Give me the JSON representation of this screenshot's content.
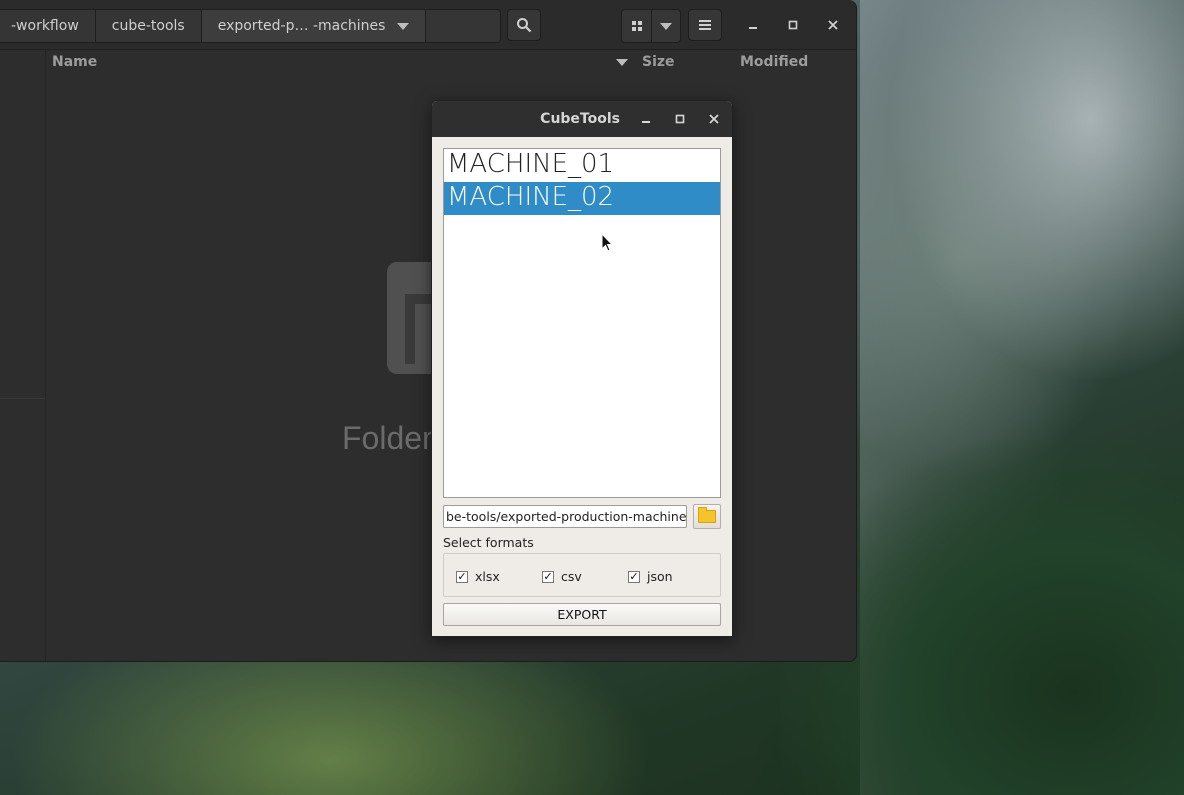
{
  "file_manager": {
    "breadcrumbs": [
      "-workflow",
      "cube-tools",
      "exported-p… -machines"
    ],
    "columns": {
      "name": "Name",
      "size": "Size",
      "modified": "Modified"
    },
    "empty_state_text": "Folder"
  },
  "dialog": {
    "title": "CubeTools",
    "machines": [
      "MACHINE_01",
      "MACHINE_02"
    ],
    "selected_machine_index": 1,
    "export_path": "be-tools/exported-production-machines",
    "formats_label": "Select formats",
    "formats": [
      {
        "label": "xlsx",
        "checked": true
      },
      {
        "label": "csv",
        "checked": true
      },
      {
        "label": "json",
        "checked": true
      }
    ],
    "export_button": "EXPORT"
  },
  "icons": {
    "fm_search": "search-icon",
    "fm_grid": "grid-view-icon",
    "fm_menu": "hamburger-menu-icon",
    "browse": "folder-icon",
    "check_mark": "✓"
  },
  "colors": {
    "selection": "#308cc6",
    "folder_icon": "#f6c32b"
  }
}
